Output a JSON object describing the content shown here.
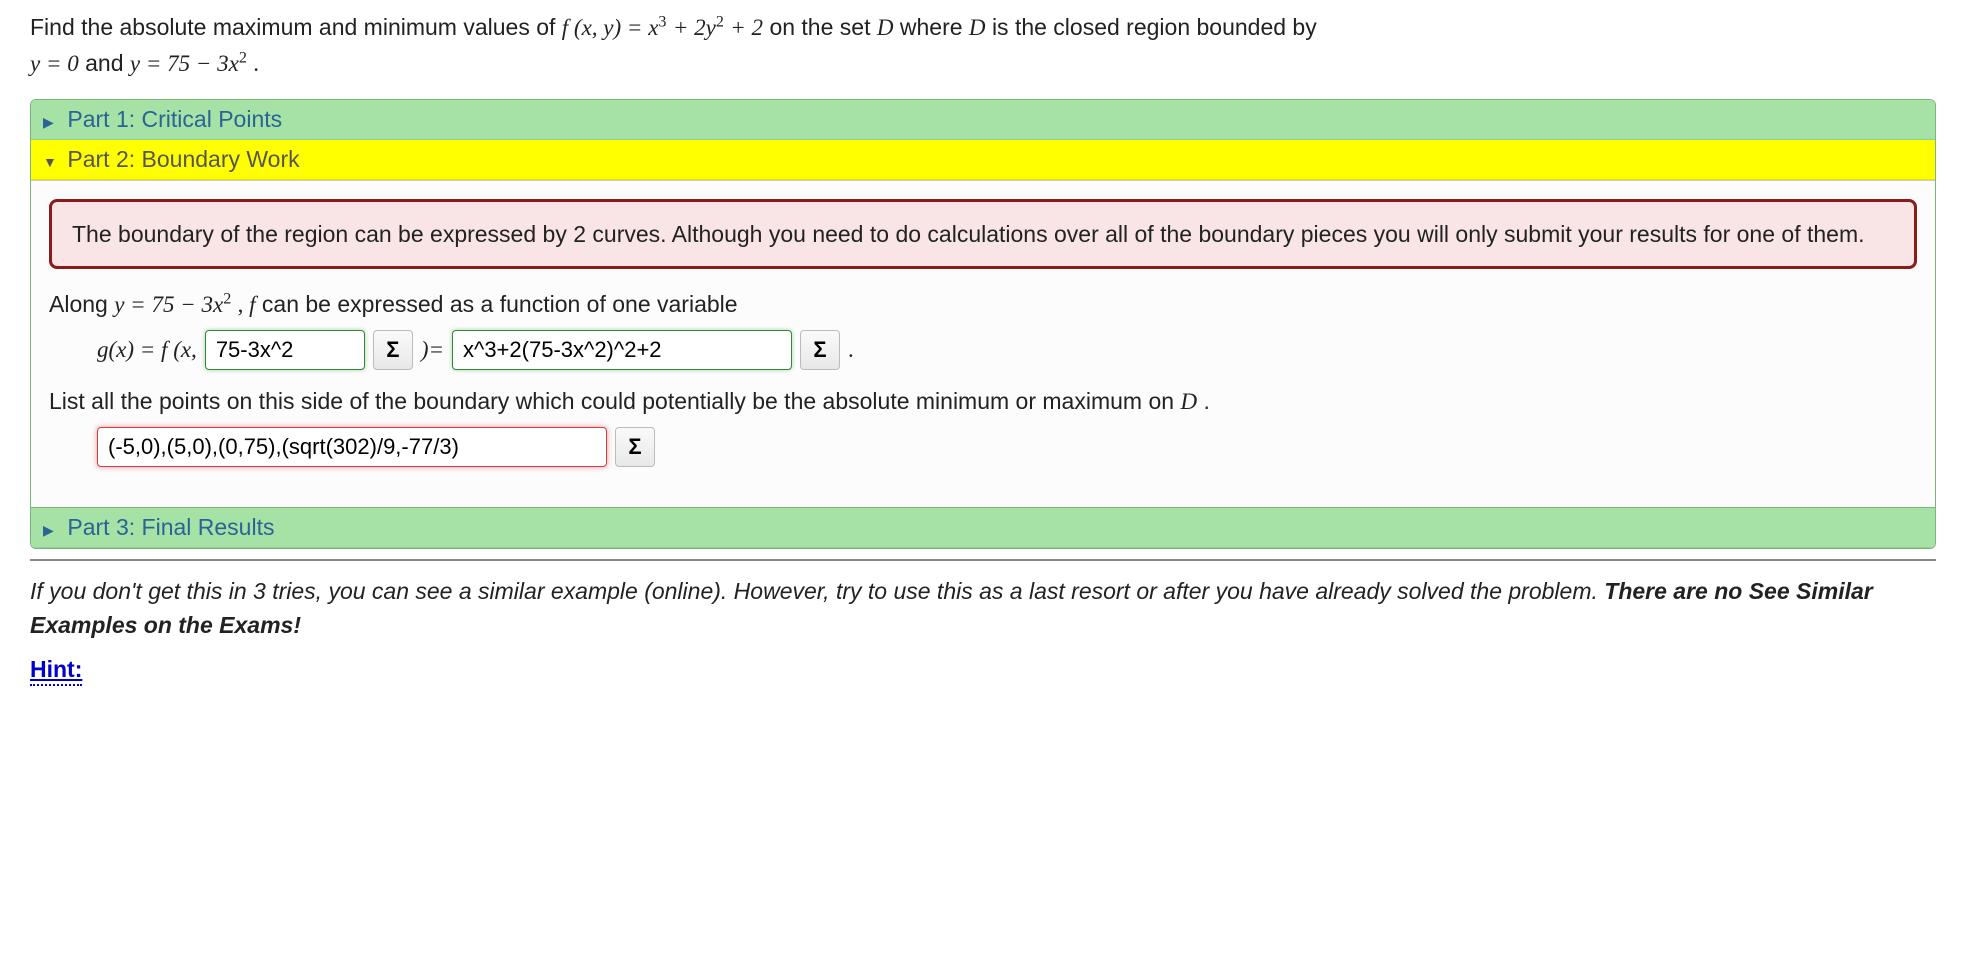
{
  "prompt": {
    "line1_pre": "Find the absolute maximum and minimum values of ",
    "fxy": "f (x, y) = x",
    "term2": " + 2y",
    "term3": " + 2",
    "line1_mid": " on the set ",
    "set": "D",
    "line1_post": " where ",
    "set2": "D",
    "line1_end": " is the closed region bounded by",
    "line2_pre": "y = 0",
    "line2_and": " and ",
    "line2_eq": "y = 75 − 3x",
    "line2_dot": "."
  },
  "parts": {
    "p1": "Part 1: Critical Points",
    "p2": "Part 2: Boundary Work",
    "p3": "Part 3: Final Results"
  },
  "warn": "The boundary of the region can be expressed by 2 curves. Although you need to do calculations over all of the boundary pieces you will only submit your results for one of them.",
  "body": {
    "along_pre": "Along ",
    "along_eq": "y = 75 − 3x",
    "along_post": ", ",
    "along_f": "f",
    "along_rest": " can be expressed as a function of one variable",
    "gx": "g(x) = f (x,",
    "close_eq": ")= ",
    "dot": " .",
    "input1": "75-3x^2",
    "input2": "x^3+2(75-3x^2)^2+2",
    "list_pre": "List all the points on this side of the boundary which could potentially be the absolute minimum or maximum on ",
    "list_D": "D",
    "list_post": ".",
    "input3": "(-5,0),(5,0),(0,75),(sqrt(302)/9,-77/3)"
  },
  "sigma": "Σ",
  "footer": {
    "text": "If you don't get this in 3 tries, you can see a similar example (online). However, try to use this as a last resort or after you have already solved the problem. ",
    "bold": "There are no See Similar Examples on the Exams!",
    "hint": "Hint:"
  }
}
